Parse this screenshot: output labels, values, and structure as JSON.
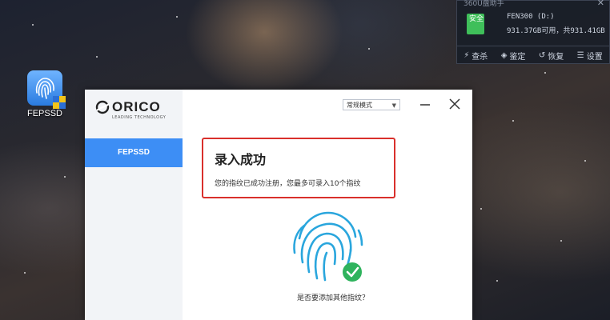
{
  "desktop": {
    "icon_label": "FEPSSD"
  },
  "widget": {
    "title": "360U盘助手",
    "status": "安全",
    "drive_name": "FEN300 (D:)",
    "drive_info": "931.37GB可用，共931.41GB",
    "actions": [
      {
        "label": "查杀",
        "icon": "bolt-icon"
      },
      {
        "label": "鉴定",
        "icon": "shield-icon"
      },
      {
        "label": "恢复",
        "icon": "restore-icon"
      },
      {
        "label": "设置",
        "icon": "menu-icon"
      }
    ]
  },
  "app": {
    "brand": "ORICO",
    "brand_tagline": "LEADING TECHNOLOGY",
    "sidebar": {
      "items": [
        {
          "label": "FEPSSD",
          "active": true
        }
      ]
    },
    "mode_select": {
      "value": "常规模式"
    },
    "success": {
      "title": "录入成功",
      "description": "您的指纹已成功注册，您最多可录入10个指纹"
    },
    "question": "是否要添加其他指纹？"
  },
  "colors": {
    "accent": "#3d8ef5",
    "highlight_border": "#d9302c",
    "check": "#2fb35d",
    "fingerprint": "#2aa6dd"
  }
}
